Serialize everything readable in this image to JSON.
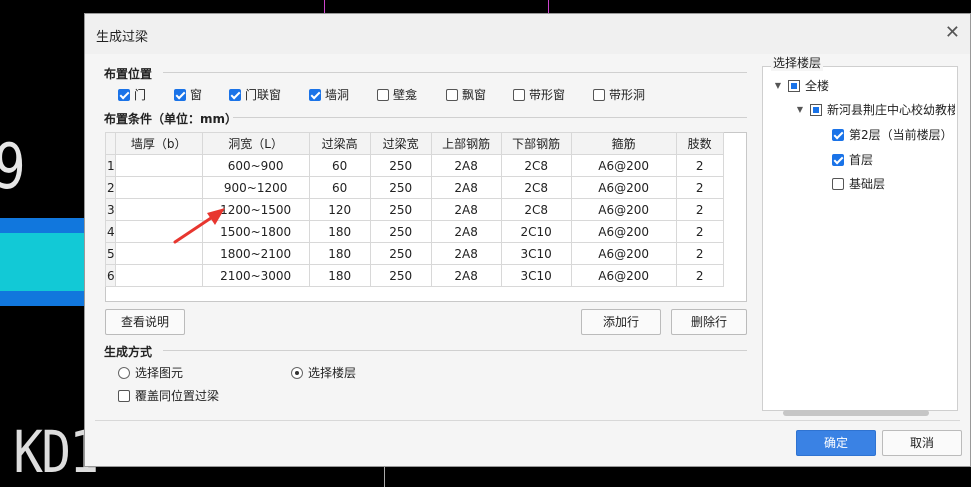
{
  "background": {
    "big_digit": "9",
    "label": "KD1"
  },
  "dialog": {
    "title": "生成过梁",
    "placement": {
      "label": "布置位置",
      "options": [
        {
          "label": "门",
          "checked": true
        },
        {
          "label": "窗",
          "checked": true
        },
        {
          "label": "门联窗",
          "checked": true
        },
        {
          "label": "墙洞",
          "checked": true
        },
        {
          "label": "壁龛",
          "checked": false
        },
        {
          "label": "飘窗",
          "checked": false
        },
        {
          "label": "带形窗",
          "checked": false
        },
        {
          "label": "带形洞",
          "checked": false
        }
      ]
    },
    "conditions": {
      "label": "布置条件（单位：mm）",
      "headers": [
        "墙厚（b）",
        "洞宽（L）",
        "过梁高",
        "过梁宽",
        "上部钢筋",
        "下部钢筋",
        "箍筋",
        "肢数"
      ],
      "rows": [
        {
          "n": "1",
          "wall": "",
          "width": "600~900",
          "h": "60",
          "w": "250",
          "top": "2A8",
          "bot": "2C8",
          "stir": "A6@200",
          "legs": "2"
        },
        {
          "n": "2",
          "wall": "",
          "width": "900~1200",
          "h": "60",
          "w": "250",
          "top": "2A8",
          "bot": "2C8",
          "stir": "A6@200",
          "legs": "2"
        },
        {
          "n": "3",
          "wall": "",
          "width": "1200~1500",
          "h": "120",
          "w": "250",
          "top": "2A8",
          "bot": "2C8",
          "stir": "A6@200",
          "legs": "2"
        },
        {
          "n": "4",
          "wall": "",
          "width": "1500~1800",
          "h": "180",
          "w": "250",
          "top": "2A8",
          "bot": "2C10",
          "stir": "A6@200",
          "legs": "2"
        },
        {
          "n": "5",
          "wall": "",
          "width": "1800~2100",
          "h": "180",
          "w": "250",
          "top": "2A8",
          "bot": "3C10",
          "stir": "A6@200",
          "legs": "2"
        },
        {
          "n": "6",
          "wall": "",
          "width": "2100~3000",
          "h": "180",
          "w": "250",
          "top": "2A8",
          "bot": "3C10",
          "stir": "A6@200",
          "legs": "2"
        }
      ]
    },
    "buttons": {
      "help": "查看说明",
      "add_row": "添加行",
      "delete_row": "删除行",
      "ok": "确定",
      "cancel": "取消"
    },
    "method": {
      "label": "生成方式",
      "radio_element": "选择图元",
      "radio_floor": "选择楼层",
      "selected": "floor",
      "overwrite": {
        "label": "覆盖同位置过梁",
        "checked": false
      }
    },
    "floors": {
      "label": "选择楼层",
      "root": "全楼",
      "project": "新河县荆庄中心校幼教楼",
      "items": [
        {
          "label": "第2层（当前楼层）",
          "checked": true
        },
        {
          "label": "首层",
          "checked": true
        },
        {
          "label": "基础层",
          "checked": false
        }
      ]
    },
    "colors": {
      "accent": "#1a73e8",
      "annotation_arrow": "#e8362f"
    }
  }
}
